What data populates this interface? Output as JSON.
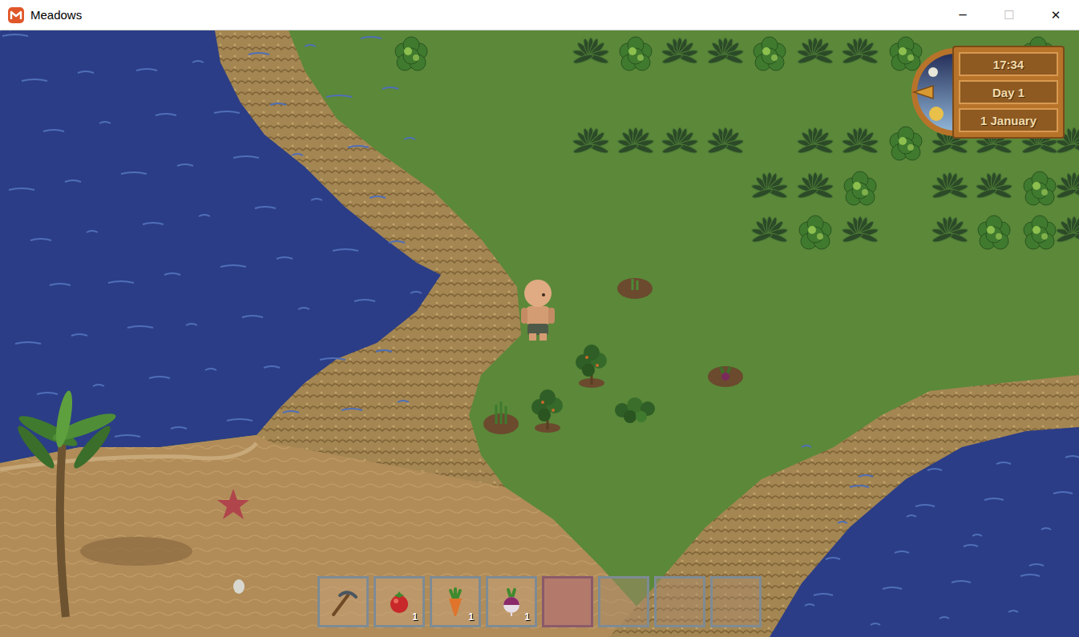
{
  "window": {
    "title": "Meadows",
    "controls": [
      {
        "label": "─",
        "disabled": false
      },
      {
        "label": "☐",
        "disabled": true
      },
      {
        "label": "✕",
        "disabled": false
      }
    ]
  },
  "clock": {
    "time": "17:34",
    "day": "Day 1",
    "date": "1 January"
  },
  "hotbar": [
    {
      "kind": "hoe",
      "selected": false
    },
    {
      "kind": "tomato",
      "count": "1",
      "selected": false
    },
    {
      "kind": "carrot",
      "count": "1",
      "selected": false
    },
    {
      "kind": "turnip",
      "count": "1",
      "selected": false
    },
    {
      "kind": "empty",
      "selected": true
    },
    {
      "kind": "empty",
      "selected": false
    },
    {
      "kind": "empty",
      "selected": false
    },
    {
      "kind": "empty",
      "selected": false
    }
  ]
}
